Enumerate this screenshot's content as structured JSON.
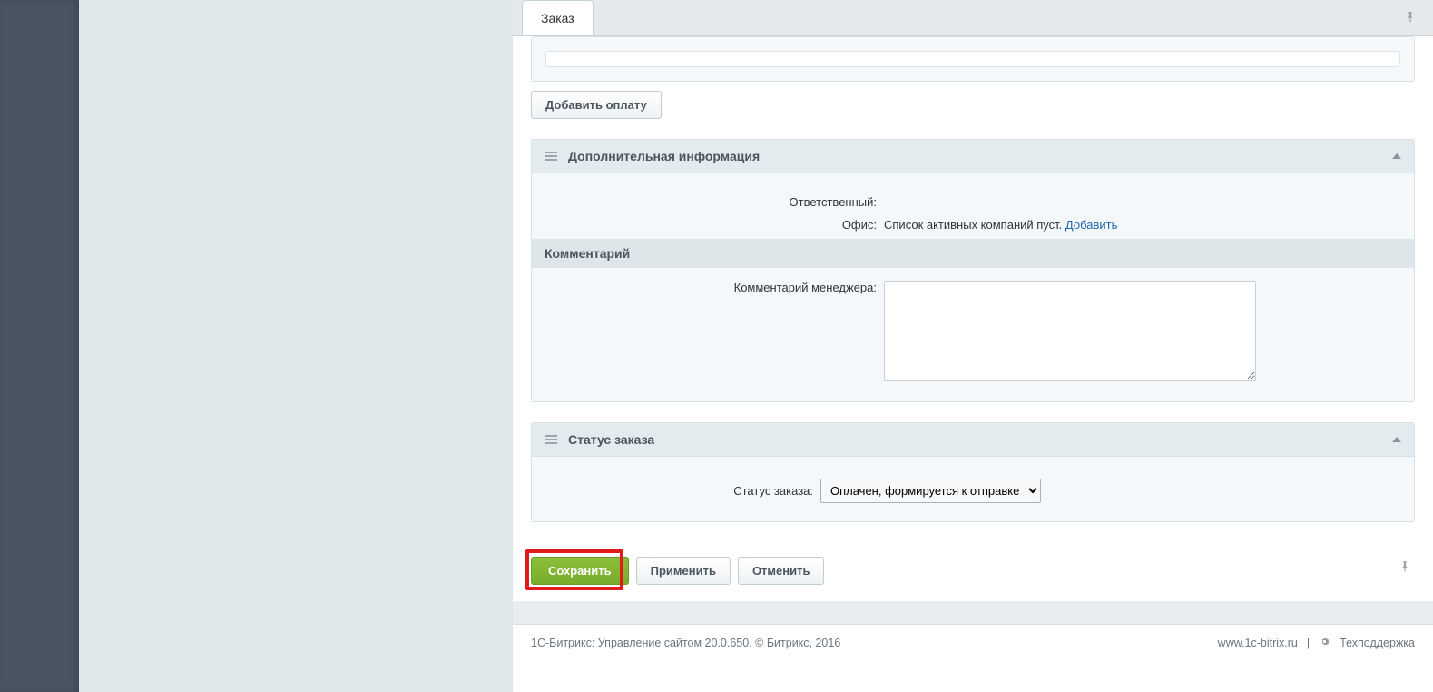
{
  "tab": {
    "label": "Заказ"
  },
  "payment": {
    "add_button": "Добавить оплату"
  },
  "extra": {
    "title": "Дополнительная информация",
    "responsible_label": "Ответственный:",
    "office_label": "Офис:",
    "office_value": "Список активных компаний пуст.",
    "office_add": "Добавить",
    "comment_header": "Комментарий",
    "comment_label": "Комментарий менеджера:",
    "comment_value": ""
  },
  "status": {
    "title": "Статус заказа",
    "label": "Статус заказа:",
    "selected": "Оплачен, формируется к отправке"
  },
  "actions": {
    "save": "Сохранить",
    "apply": "Применить",
    "cancel": "Отменить"
  },
  "footer": {
    "left": "1С-Битрикс: Управление сайтом 20.0.650. © Битрикс, 2016",
    "site": "www.1c-bitrix.ru",
    "support": "Техподдержка"
  }
}
